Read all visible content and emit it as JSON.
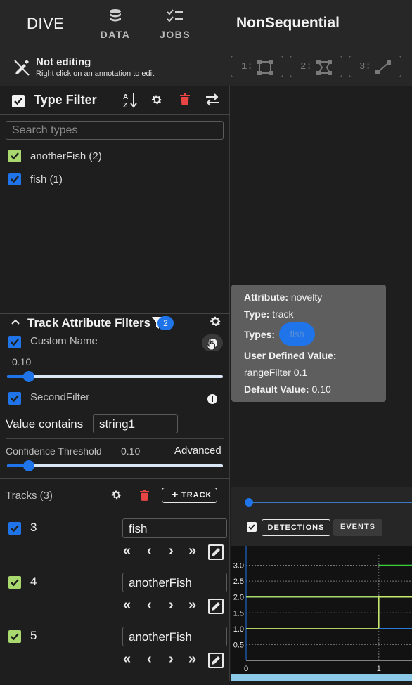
{
  "app": {
    "brand": "DIVE",
    "dataset_name": "NonSequential"
  },
  "nav": {
    "data_label": "DATA",
    "jobs_label": "JOBS"
  },
  "edit_status": {
    "title": "Not editing",
    "subtitle": "Right click on an annotation to edit"
  },
  "edit_modes": [
    {
      "key": "1:"
    },
    {
      "key": "2:"
    },
    {
      "key": "3:"
    }
  ],
  "type_filter": {
    "title": "Type Filter",
    "search_placeholder": "Search types",
    "types": [
      {
        "label": "anotherFish (2)",
        "color": "#a8d86e",
        "checked": true
      },
      {
        "label": "fish (1)",
        "color": "#1e74e8",
        "checked": true
      }
    ]
  },
  "track_attribute_filters": {
    "title": "Track Attribute Filters",
    "active_count": "2",
    "filters": [
      {
        "name": "Custom Name",
        "value_label": "0.10",
        "value": 0.1
      },
      {
        "name": "SecondFilter",
        "contains_label": "Value contains",
        "contains_value": "string1"
      }
    ]
  },
  "confidence": {
    "label": "Confidence Threshold",
    "value_label": "0.10",
    "value": 0.1,
    "advanced_label": "Advanced"
  },
  "tracks": {
    "header": "Tracks (3)",
    "add_label": "TRACK",
    "items": [
      {
        "id": "3",
        "type": "fish",
        "color": "#1e74e8"
      },
      {
        "id": "4",
        "type": "anotherFish",
        "color": "#a8d86e"
      },
      {
        "id": "5",
        "type": "anotherFish",
        "color": "#a8d86e"
      }
    ],
    "nav_glyphs": {
      "first": "«",
      "prev": "‹",
      "next": "›",
      "last": "»"
    }
  },
  "tooltip": {
    "attribute_label": "Attribute:",
    "attribute_value": "novelty",
    "type_label": "Type:",
    "type_value": "track",
    "types_label": "Types:",
    "types_chip": "fish",
    "user_value_label": "User Defined Value:",
    "user_value": "rangeFilter 0.1",
    "default_label": "Default Value:",
    "default_value": "0.10"
  },
  "timeline": {
    "detections_label": "DETECTIONS",
    "events_label": "EVENTS"
  },
  "chart_data": {
    "type": "line",
    "y_ticks": [
      "3.0",
      "2.5",
      "2.0",
      "1.5",
      "1.0",
      "0.5"
    ],
    "x_ticks": [
      "0",
      "1"
    ],
    "ylim": [
      0,
      3.3
    ],
    "xlim": [
      0,
      1.25
    ],
    "series": [
      {
        "color": "#3ad13a",
        "points": [
          [
            1,
            3
          ],
          [
            1.25,
            3
          ]
        ]
      },
      {
        "color": "#a8d86e",
        "points": [
          [
            0,
            2
          ],
          [
            1,
            2
          ],
          [
            1,
            1
          ],
          [
            1.25,
            1
          ]
        ]
      },
      {
        "color": "#c8e870",
        "points": [
          [
            0,
            1
          ],
          [
            1,
            1
          ],
          [
            1,
            2
          ],
          [
            1.25,
            2
          ]
        ]
      },
      {
        "color": "#1e74e8",
        "points": [
          [
            1,
            1
          ],
          [
            1.25,
            1
          ]
        ]
      }
    ]
  }
}
